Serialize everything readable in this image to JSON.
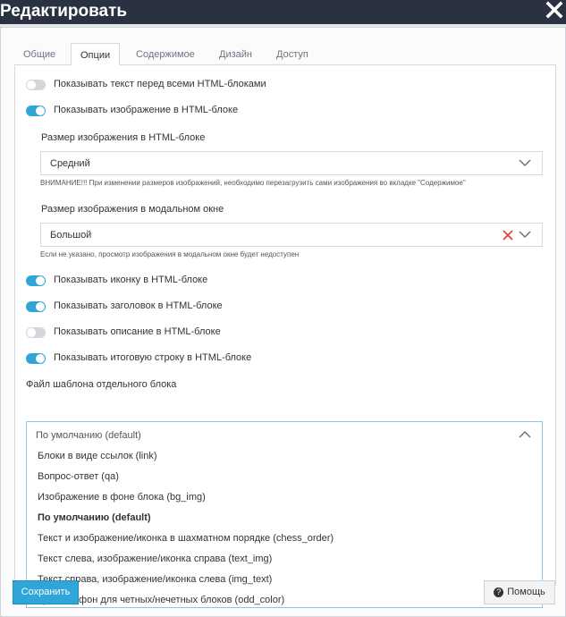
{
  "window": {
    "title": "Редактировать"
  },
  "tabs": [
    {
      "label": "Общие"
    },
    {
      "label": "Опции",
      "active": true
    },
    {
      "label": "Содержимое"
    },
    {
      "label": "Дизайн"
    },
    {
      "label": "Доступ"
    }
  ],
  "toggles": [
    {
      "label": "Показывать текст перед всеми HTML-блоками",
      "on": false
    },
    {
      "label": "Показывать изображение в HTML-блоке",
      "on": true
    },
    {
      "label": "Показывать иконку в HTML-блоке",
      "on": true
    },
    {
      "label": "Показывать заголовок в HTML-блоке",
      "on": true
    },
    {
      "label": "Показывать описание в HTML-блоке",
      "on": false
    },
    {
      "label": "Показывать итоговую строку в HTML-блоке",
      "on": true
    }
  ],
  "image_size": {
    "label": "Размер изображения в HTML-блоке",
    "value": "Средний",
    "note": "ВНИМАНИЕ!!! При изменении размеров изображений, необходимо перезагрузить сами изображения во вкладке \"Содержимое\""
  },
  "modal_size": {
    "label": "Размер изображения в модальном окне",
    "value": "Большой",
    "note": "Если не указано, просмотр изображения в модальном окне будет недоступен"
  },
  "template": {
    "label": "Файл шаблона отдельного блока",
    "value": "По умолчанию (default)",
    "options": [
      "Блоки в виде ссылок (link)",
      "Вопрос-ответ (qa)",
      "Изображение в фоне блока (bg_img)",
      "По умолчанию (default)",
      "Текст и изображение/иконка в шахматном порядке (chess_order)",
      "Текст слева, изображение/иконка справа (text_img)",
      "Текст справа, изображение/иконка слева (img_text)",
      "Цветной фон для четных/нечетных блоков (odd_color)"
    ],
    "selected_index": 3
  },
  "buttons": {
    "save": "Сохранить",
    "help": "Помощь"
  },
  "colors": {
    "accent": "#2fa5d8",
    "titlebar": "#2a3140",
    "error": "#e0443e"
  }
}
